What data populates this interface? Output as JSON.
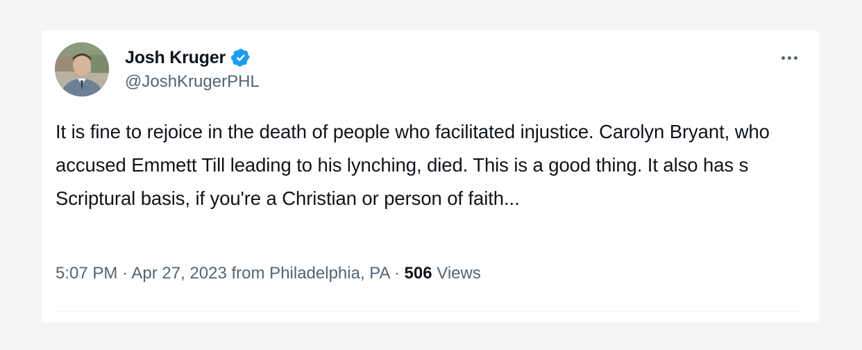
{
  "tweet": {
    "author": {
      "display_name": "Josh Kruger",
      "handle": "@JoshKrugerPHL",
      "verified": true
    },
    "more_icon": "more-horizontal-icon",
    "text": "It is fine to rejoice in the death of people who facilitated injustice. Carolyn Bryant, who accused Emmett Till leading to his lynching, died. This is a good thing. It also has s Scriptural basis, if you're a Christian or person of faith...",
    "meta": {
      "time": "5:07 PM",
      "separator": "·",
      "date": "Apr 27, 2023",
      "location": "from Philadelphia, PA",
      "views_count": "506",
      "views_label": "Views"
    }
  },
  "colors": {
    "background": "#f5f5f5",
    "card": "#ffffff",
    "text_primary": "#0f1419",
    "text_secondary": "#536471",
    "verified_blue": "#1d9bf0"
  }
}
